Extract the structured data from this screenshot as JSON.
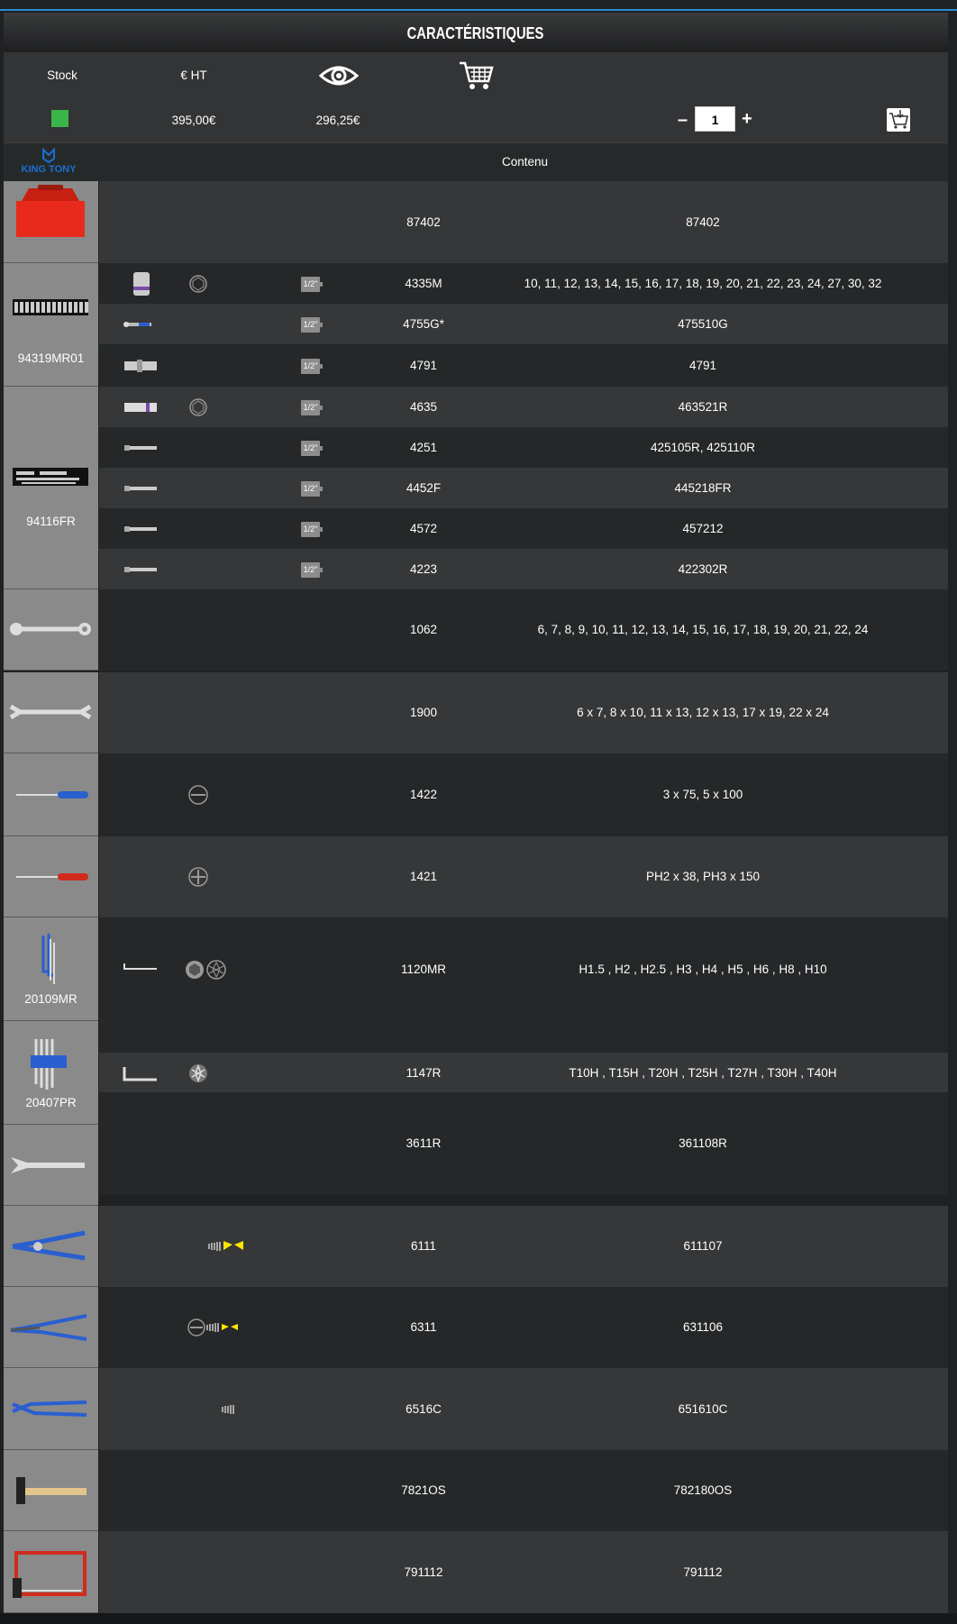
{
  "header": {
    "title": "CARACTÉRISTIQUES",
    "col_stock": "Stock",
    "col_price": "€ HT",
    "price_list": "395,00€",
    "price_net": "296,25€",
    "quantity": "1",
    "minus": "–",
    "plus": "+",
    "contenu": "Contenu",
    "brand": "KING TONY"
  },
  "colors": {
    "accent": "#2a8fd6",
    "stock_ok": "#3ab54a",
    "yellow": "#ffe600"
  },
  "kits": [
    {
      "label": ""
    },
    {
      "label": "94319MR01"
    },
    {
      "label": "94116FR"
    },
    {
      "label": ""
    },
    {
      "label": ""
    },
    {
      "label": ""
    },
    {
      "label": ""
    },
    {
      "label": "20109MR"
    },
    {
      "label": "20407PR"
    },
    {
      "label": ""
    },
    {
      "label": ""
    },
    {
      "label": ""
    },
    {
      "label": ""
    },
    {
      "label": ""
    },
    {
      "label": ""
    }
  ],
  "rows": [
    {
      "code": "87402",
      "content": "87402",
      "drive": ""
    },
    {
      "code": "4335M",
      "content": "10, 11, 12, 13, 14, 15, 16, 17, 18, 19, 20, 21, 22, 23, 24, 27, 30, 32",
      "drive": "1/2\""
    },
    {
      "code": "4755G*",
      "content": "475510G",
      "drive": "1/2\""
    },
    {
      "code": "4791",
      "content": "4791",
      "drive": "1/2\""
    },
    {
      "code": "4635",
      "content": "463521R",
      "drive": "1/2\""
    },
    {
      "code": "4251",
      "content": "425105R, 425110R",
      "drive": "1/2\""
    },
    {
      "code": "4452F",
      "content": "445218FR",
      "drive": "1/2\""
    },
    {
      "code": "4572",
      "content": "457212",
      "drive": "1/2\""
    },
    {
      "code": "4223",
      "content": "422302R",
      "drive": "1/2\""
    },
    {
      "code": "1062",
      "content": "6, 7, 8, 9, 10, 11, 12, 13, 14, 15, 16, 17, 18, 19, 20, 21, 22, 24",
      "drive": ""
    },
    {
      "code": "1900",
      "content": "6 x 7, 8 x 10, 11 x 13, 12 x 13, 17 x 19, 22 x 24",
      "drive": ""
    },
    {
      "code": "1422",
      "content": "3 x 75, 5 x 100",
      "drive": ""
    },
    {
      "code": "1421",
      "content": "PH2 x 38, PH3 x 150",
      "drive": ""
    },
    {
      "code": "1120MR",
      "content": "H1.5 , H2 , H2.5 , H3 , H4 , H5 , H6 , H8 , H10",
      "drive": ""
    },
    {
      "code": "1147R",
      "content": "T10H , T15H , T20H , T25H , T27H , T30H , T40H",
      "drive": ""
    },
    {
      "code": "3611R",
      "content": "361108R",
      "drive": ""
    },
    {
      "code": "6111",
      "content": "611107",
      "drive": ""
    },
    {
      "code": "6311",
      "content": "631106",
      "drive": ""
    },
    {
      "code": "6516C",
      "content": "651610C",
      "drive": ""
    },
    {
      "code": "7821OS",
      "content": "782180OS",
      "drive": ""
    },
    {
      "code": "791112",
      "content": "791112",
      "drive": ""
    }
  ]
}
